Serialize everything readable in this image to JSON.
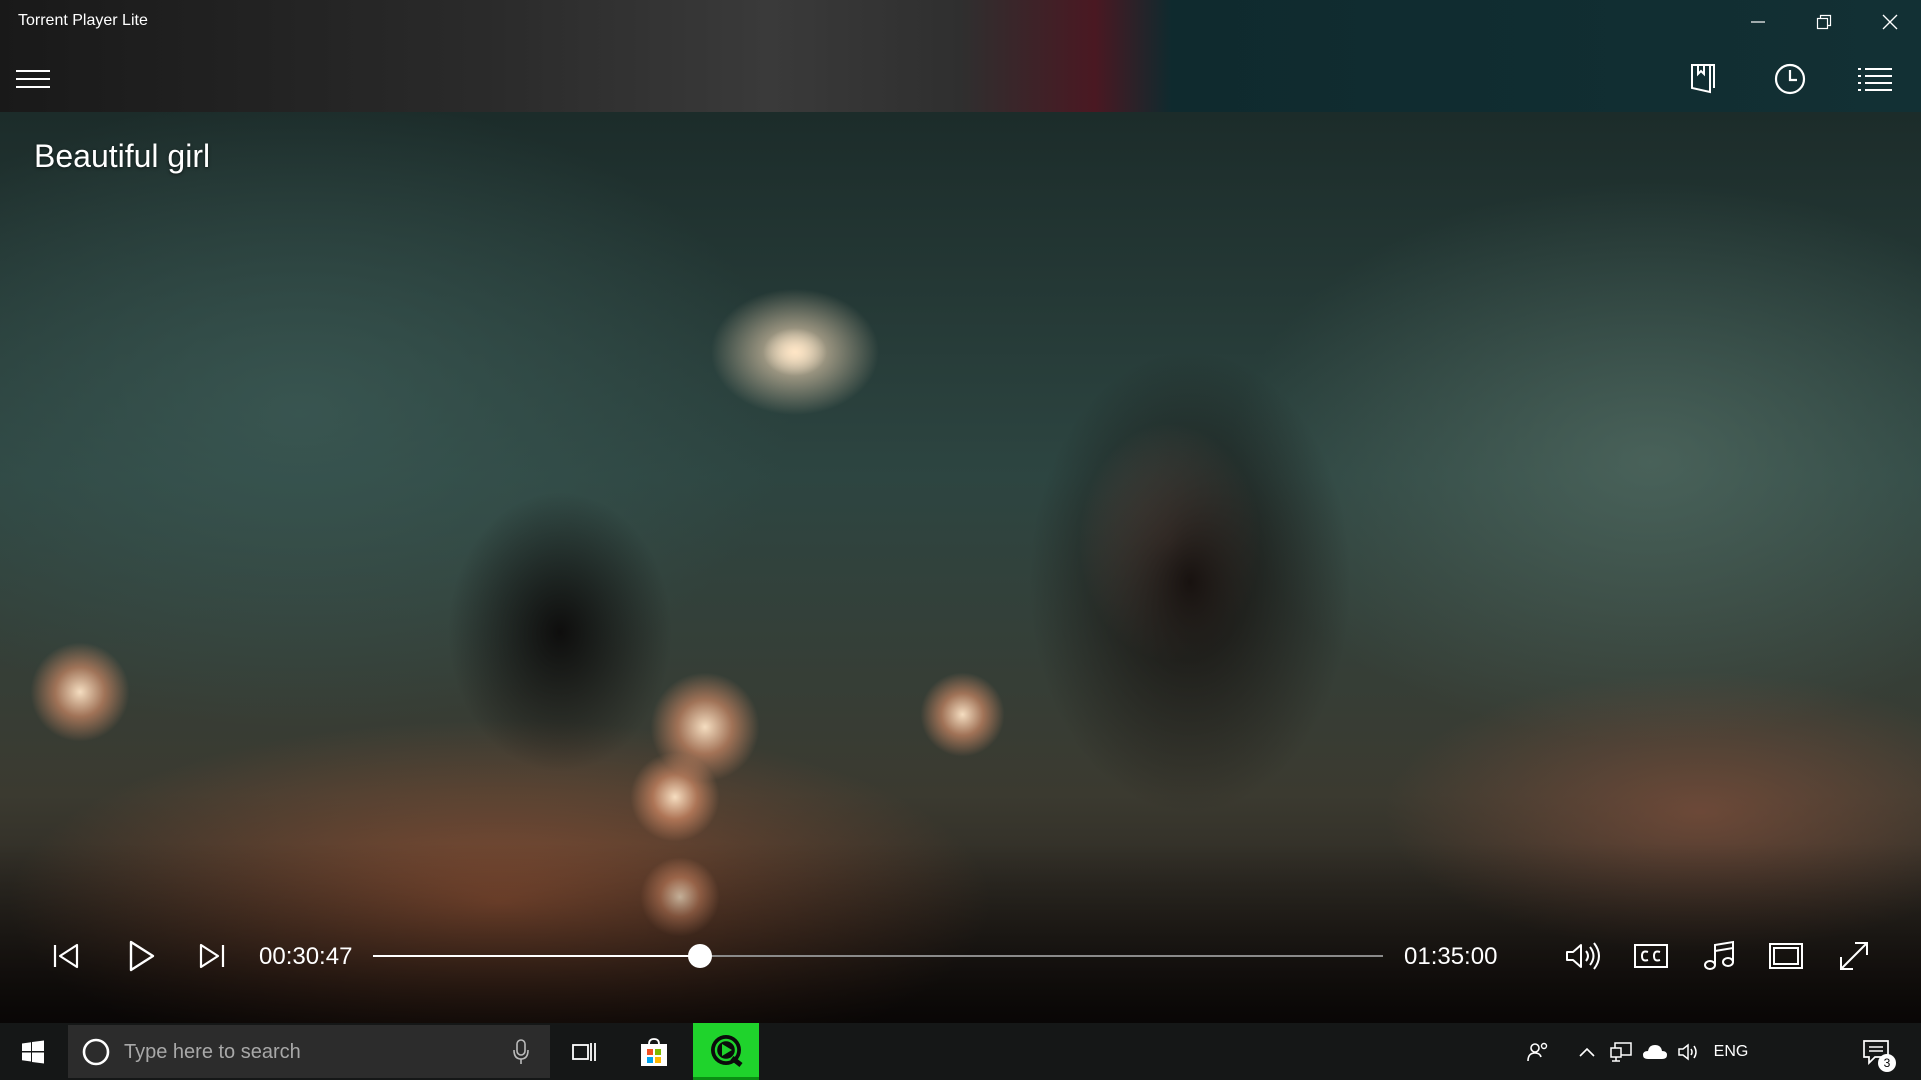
{
  "window": {
    "title": "Torrent Player Lite",
    "buttons": [
      "minimize",
      "restore",
      "close"
    ]
  },
  "toolbar": {
    "menu_icon": "hamburger-menu-icon",
    "right_icons": [
      "bookmark-icon",
      "history-clock-icon",
      "playlist-icon"
    ]
  },
  "video": {
    "title": "Beautiful girl"
  },
  "player": {
    "current_time": "00:30:47",
    "total_time": "01:35:00",
    "progress_fraction": 0.324,
    "controls_left": [
      "previous-icon",
      "play-icon",
      "next-icon"
    ],
    "controls_right": [
      "volume-icon",
      "closed-captions-icon",
      "audio-track-icon",
      "aspect-ratio-icon",
      "fullscreen-icon"
    ]
  },
  "taskbar": {
    "search_placeholder": "Type here to search",
    "language": "ENG",
    "notification_count": "3",
    "colors": {
      "active_app": "#1fd32c",
      "bar": "#151717"
    }
  }
}
